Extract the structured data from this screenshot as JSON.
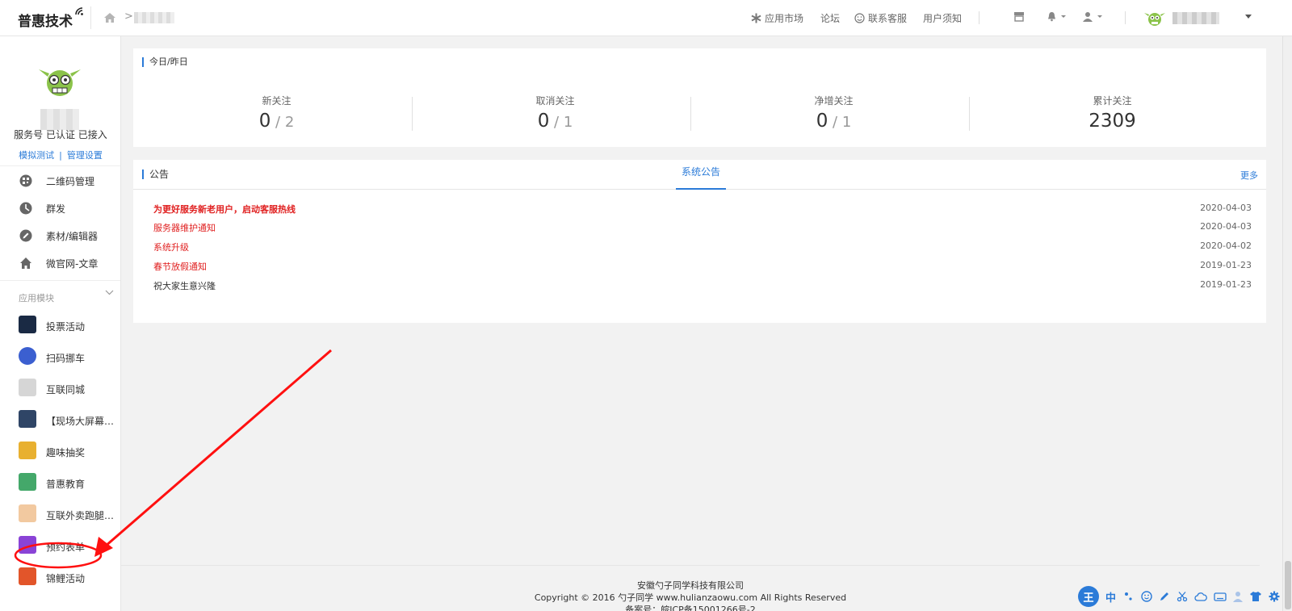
{
  "topbar": {
    "logo": "普惠技术",
    "nav": {
      "app_market": "应用市场",
      "forum": "论坛",
      "contact": "联系客服",
      "notice": "用户须知"
    }
  },
  "sidebar": {
    "account_status": "服务号 已认证 已接入",
    "link_test": "模拟测试",
    "link_sep": "|",
    "link_manage": "管理设置",
    "menu": [
      {
        "label": "二维码管理",
        "icon": "qrcode-icon"
      },
      {
        "label": "群发",
        "icon": "broadcast-icon"
      },
      {
        "label": "素材/编辑器",
        "icon": "edit-icon"
      },
      {
        "label": "微官网-文章",
        "icon": "home-icon"
      }
    ],
    "section_title": "应用模块",
    "apps": [
      {
        "label": "投票活动",
        "color": "#1a2a44"
      },
      {
        "label": "扫码挪车",
        "color": "#3b5fd0"
      },
      {
        "label": "互联同城",
        "color": "#d6d6d6"
      },
      {
        "label": "【现场大屏幕】...",
        "color": "#2f4566"
      },
      {
        "label": "趣味抽奖",
        "color": "#e8b030"
      },
      {
        "label": "普惠教育",
        "color": "#44a86a"
      },
      {
        "label": "互联外卖跑腿系统",
        "color": "#f2c9a0"
      },
      {
        "label": "预约表单",
        "color": "#8a43d6"
      },
      {
        "label": "锦鲤活动",
        "color": "#e2552a"
      }
    ]
  },
  "stats": {
    "title": "今日/昨日",
    "items": [
      {
        "label": "新关注",
        "today": "0",
        "yesterday": "2"
      },
      {
        "label": "取消关注",
        "today": "0",
        "yesterday": "1"
      },
      {
        "label": "净增关注",
        "today": "0",
        "yesterday": "1"
      },
      {
        "label": "累计关注",
        "total": "2309"
      }
    ]
  },
  "notices": {
    "title": "公告",
    "tab": "系统公告",
    "more": "更多",
    "items": [
      {
        "text": "为更好服务新老用户，启动客服热线",
        "date": "2020-04-03"
      },
      {
        "text": "服务器维护通知",
        "date": "2020-04-03"
      },
      {
        "text": "系统升级",
        "date": "2020-04-02"
      },
      {
        "text": "春节放假通知",
        "date": "2019-01-23"
      },
      {
        "text": "祝大家生意兴隆",
        "date": "2019-01-23"
      }
    ]
  },
  "footer": {
    "company": "安徽勺子同学科技有限公司",
    "copyright": "Copyright © 2016 勺子同学 www.hulianzaowu.com All Rights Reserved",
    "icp": "备案号：皖ICP备15001266号-2"
  },
  "ime": {
    "badge": "王",
    "lang": "中"
  },
  "colors": {
    "accent": "#2b7bd8",
    "alert_red": "#e02020"
  }
}
